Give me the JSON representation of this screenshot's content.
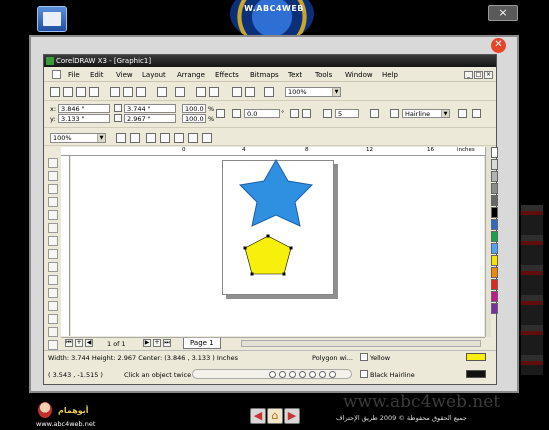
{
  "top": {
    "logo_text": "W.ABC4WEB"
  },
  "window": {
    "title": "CorelDRAW X3 - [Graphic1]",
    "menu": [
      "File",
      "Edit",
      "View",
      "Layout",
      "Arrange",
      "Effects",
      "Bitmaps",
      "Text",
      "Tools",
      "Window",
      "Help"
    ],
    "win_buttons": [
      "_",
      "□",
      "×"
    ]
  },
  "toolbar": {
    "zoom_std": "100%",
    "x": "3.846 \"",
    "y": "3.133 \"",
    "w": "3.744 \"",
    "h": "2.967 \"",
    "scale_x": "100.0",
    "scale_y": "100.0",
    "angle": "0.0",
    "sides": "5",
    "outline": "Hairline",
    "zoom2": "100%"
  },
  "ruler": {
    "ticks": [
      "0",
      "4",
      "8",
      "12",
      "16"
    ],
    "unit": "inches"
  },
  "pagebar": {
    "page_count": "1 of 1",
    "page_tab": "Page 1"
  },
  "status": {
    "dims": "Width: 3.744  Height: 2.967  Center: (3.846 , 3.133 )  Inches",
    "object": "Polygon wi...",
    "fill_name": "Yellow",
    "coords": "( 3.543 , -1.515 )",
    "hint": "Click an object twice",
    "outline_name": "Black  Hairline"
  },
  "palette": [
    "#ffffff",
    "#d9d9d9",
    "#b3b3b3",
    "#8c8c8c",
    "#666666",
    "#000000",
    "#2a6ac8",
    "#16a34a",
    "#4fa0ff",
    "#f5e400",
    "#f08a00",
    "#e5261f",
    "#c0198c",
    "#7a2fa0"
  ],
  "colors": {
    "star": "#2f8fe0",
    "pentagon": "#f7ef0c",
    "fill": "#f7ef0c",
    "outline": "#000000"
  },
  "bottom": {
    "brand_ar": "أبوهمام",
    "brand_url": "www.abc4web.net",
    "watermark": "www.abc4web.net",
    "copyright": "جميع الحقوق محفوظة © 2009 طريق الإحتراف"
  }
}
